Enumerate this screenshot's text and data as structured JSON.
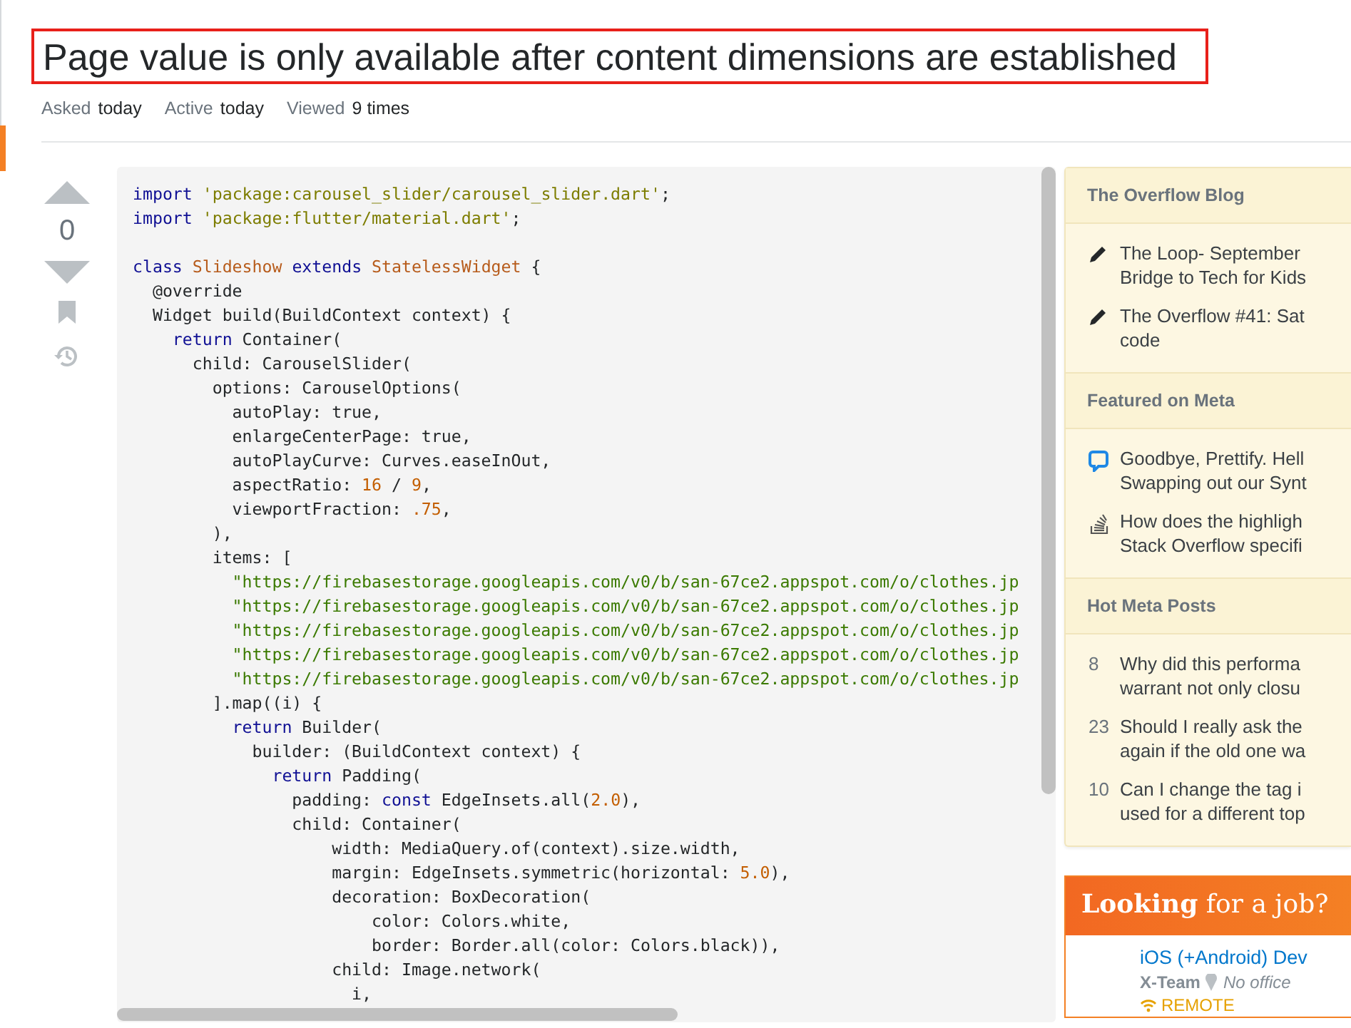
{
  "question": {
    "title": "Page value is only available after content dimensions are established",
    "highlighted": true,
    "meta": [
      {
        "label": "Asked",
        "value": "today"
      },
      {
        "label": "Active",
        "value": "today"
      },
      {
        "label": "Viewed",
        "value": "9 times"
      }
    ]
  },
  "post": {
    "score": "0",
    "code_lines": [
      {
        "kind": "code",
        "parts": [
          {
            "kind": "keyword",
            "text": "import "
          },
          {
            "kind": "string",
            "text": "'package:carousel_slider/carousel_slider.dart'"
          },
          {
            "kind": "plain",
            "text": ";"
          }
        ]
      },
      {
        "kind": "code",
        "parts": [
          {
            "kind": "keyword",
            "text": "import "
          },
          {
            "kind": "string",
            "text": "'package:flutter/material.dart'"
          },
          {
            "kind": "plain",
            "text": ";"
          }
        ]
      },
      {
        "kind": "blank"
      },
      {
        "kind": "code",
        "parts": [
          {
            "kind": "keyword",
            "text": "class "
          },
          {
            "kind": "type",
            "text": "Slideshow "
          },
          {
            "kind": "keyword",
            "text": "extends "
          },
          {
            "kind": "type",
            "text": "StatelessWidget"
          },
          {
            "kind": "plain",
            "text": " {"
          }
        ]
      },
      {
        "kind": "code",
        "parts": [
          {
            "kind": "plain",
            "text": "  @override"
          }
        ]
      },
      {
        "kind": "code",
        "parts": [
          {
            "kind": "plain",
            "text": "  Widget build(BuildContext context) {"
          }
        ]
      },
      {
        "kind": "code",
        "parts": [
          {
            "kind": "keyword",
            "text": "    return"
          },
          {
            "kind": "plain",
            "text": " Container("
          }
        ]
      },
      {
        "kind": "code",
        "parts": [
          {
            "kind": "plain",
            "text": "      child: CarouselSlider("
          }
        ]
      },
      {
        "kind": "code",
        "parts": [
          {
            "kind": "plain",
            "text": "        options: CarouselOptions("
          }
        ]
      },
      {
        "kind": "code",
        "parts": [
          {
            "kind": "plain",
            "text": "          autoPlay: true,"
          }
        ]
      },
      {
        "kind": "code",
        "parts": [
          {
            "kind": "plain",
            "text": "          enlargeCenterPage: true,"
          }
        ]
      },
      {
        "kind": "code",
        "parts": [
          {
            "kind": "plain",
            "text": "          autoPlayCurve: Curves.easeInOut,"
          }
        ]
      },
      {
        "kind": "code",
        "parts": [
          {
            "kind": "plain",
            "text": "          aspectRatio: "
          },
          {
            "kind": "number",
            "text": "16"
          },
          {
            "kind": "plain",
            "text": " / "
          },
          {
            "kind": "number",
            "text": "9"
          },
          {
            "kind": "plain",
            "text": ","
          }
        ]
      },
      {
        "kind": "code",
        "parts": [
          {
            "kind": "plain",
            "text": "          viewportFraction: "
          },
          {
            "kind": "number",
            "text": ".75"
          },
          {
            "kind": "plain",
            "text": ","
          }
        ]
      },
      {
        "kind": "code",
        "parts": [
          {
            "kind": "plain",
            "text": "        ),"
          }
        ]
      },
      {
        "kind": "code",
        "parts": [
          {
            "kind": "plain",
            "text": "        items: ["
          }
        ]
      },
      {
        "kind": "code",
        "parts": [
          {
            "kind": "url",
            "text": "          \"https://firebasestorage.googleapis.com/v0/b/san-67ce2.appspot.com/o/clothes.jp"
          }
        ]
      },
      {
        "kind": "code",
        "parts": [
          {
            "kind": "url",
            "text": "          \"https://firebasestorage.googleapis.com/v0/b/san-67ce2.appspot.com/o/clothes.jp"
          }
        ]
      },
      {
        "kind": "code",
        "parts": [
          {
            "kind": "url",
            "text": "          \"https://firebasestorage.googleapis.com/v0/b/san-67ce2.appspot.com/o/clothes.jp"
          }
        ]
      },
      {
        "kind": "code",
        "parts": [
          {
            "kind": "url",
            "text": "          \"https://firebasestorage.googleapis.com/v0/b/san-67ce2.appspot.com/o/clothes.jp"
          }
        ]
      },
      {
        "kind": "code",
        "parts": [
          {
            "kind": "url",
            "text": "          \"https://firebasestorage.googleapis.com/v0/b/san-67ce2.appspot.com/o/clothes.jp"
          }
        ]
      },
      {
        "kind": "code",
        "parts": [
          {
            "kind": "plain",
            "text": "        ].map((i) {"
          }
        ]
      },
      {
        "kind": "code",
        "parts": [
          {
            "kind": "keyword",
            "text": "          return"
          },
          {
            "kind": "plain",
            "text": " Builder("
          }
        ]
      },
      {
        "kind": "code",
        "parts": [
          {
            "kind": "plain",
            "text": "            builder: (BuildContext context) {"
          }
        ]
      },
      {
        "kind": "code",
        "parts": [
          {
            "kind": "keyword",
            "text": "              return"
          },
          {
            "kind": "plain",
            "text": " Padding("
          }
        ]
      },
      {
        "kind": "code",
        "parts": [
          {
            "kind": "plain",
            "text": "                padding: "
          },
          {
            "kind": "keyword",
            "text": "const"
          },
          {
            "kind": "plain",
            "text": " EdgeInsets.all("
          },
          {
            "kind": "number",
            "text": "2.0"
          },
          {
            "kind": "plain",
            "text": "),"
          }
        ]
      },
      {
        "kind": "code",
        "parts": [
          {
            "kind": "plain",
            "text": "                child: Container("
          }
        ]
      },
      {
        "kind": "code",
        "parts": [
          {
            "kind": "plain",
            "text": "                    width: MediaQuery.of(context).size.width,"
          }
        ]
      },
      {
        "kind": "code",
        "parts": [
          {
            "kind": "plain",
            "text": "                    margin: EdgeInsets.symmetric(horizontal: "
          },
          {
            "kind": "number",
            "text": "5.0"
          },
          {
            "kind": "plain",
            "text": "),"
          }
        ]
      },
      {
        "kind": "code",
        "parts": [
          {
            "kind": "plain",
            "text": "                    decoration: BoxDecoration("
          }
        ]
      },
      {
        "kind": "code",
        "parts": [
          {
            "kind": "plain",
            "text": "                        color: Colors.white,"
          }
        ]
      },
      {
        "kind": "code",
        "parts": [
          {
            "kind": "plain",
            "text": "                        border: Border.all(color: Colors.black)),"
          }
        ]
      },
      {
        "kind": "code",
        "parts": [
          {
            "kind": "plain",
            "text": "                    child: Image.network("
          }
        ]
      },
      {
        "kind": "code",
        "parts": [
          {
            "kind": "plain",
            "text": "                      i,"
          }
        ]
      }
    ]
  },
  "sidebar": {
    "sections": [
      {
        "title": "The Overflow Blog",
        "items": [
          {
            "kind": "blog",
            "lines": [
              "The Loop- September",
              "Bridge to Tech for Kids"
            ]
          },
          {
            "kind": "blog",
            "lines": [
              "The Overflow #41: Sat",
              "code"
            ]
          }
        ]
      },
      {
        "title": "Featured on Meta",
        "items": [
          {
            "kind": "announcement",
            "lines": [
              "Goodbye, Prettify. Hell",
              "Swapping out our Synt"
            ]
          },
          {
            "kind": "meta_question",
            "lines": [
              "How does the highligh",
              "Stack Overflow specifi"
            ]
          }
        ]
      },
      {
        "title": "Hot Meta Posts",
        "items": [
          {
            "kind": "hot",
            "count": "8",
            "lines": [
              "Why did this performa",
              "warrant not only closu"
            ]
          },
          {
            "kind": "hot",
            "count": "23",
            "lines": [
              "Should I really ask the",
              "again if the old one wa"
            ]
          },
          {
            "kind": "hot",
            "count": "10",
            "lines": [
              "Can I change the tag i",
              "used for a different top"
            ]
          }
        ]
      }
    ]
  },
  "job_ad": {
    "heading": "**Looking** for a job?",
    "jobs": [
      {
        "title": "iOS (+Android) Dev",
        "company": "X-Team",
        "location": "No office",
        "tag": "REMOTE"
      }
    ]
  }
}
